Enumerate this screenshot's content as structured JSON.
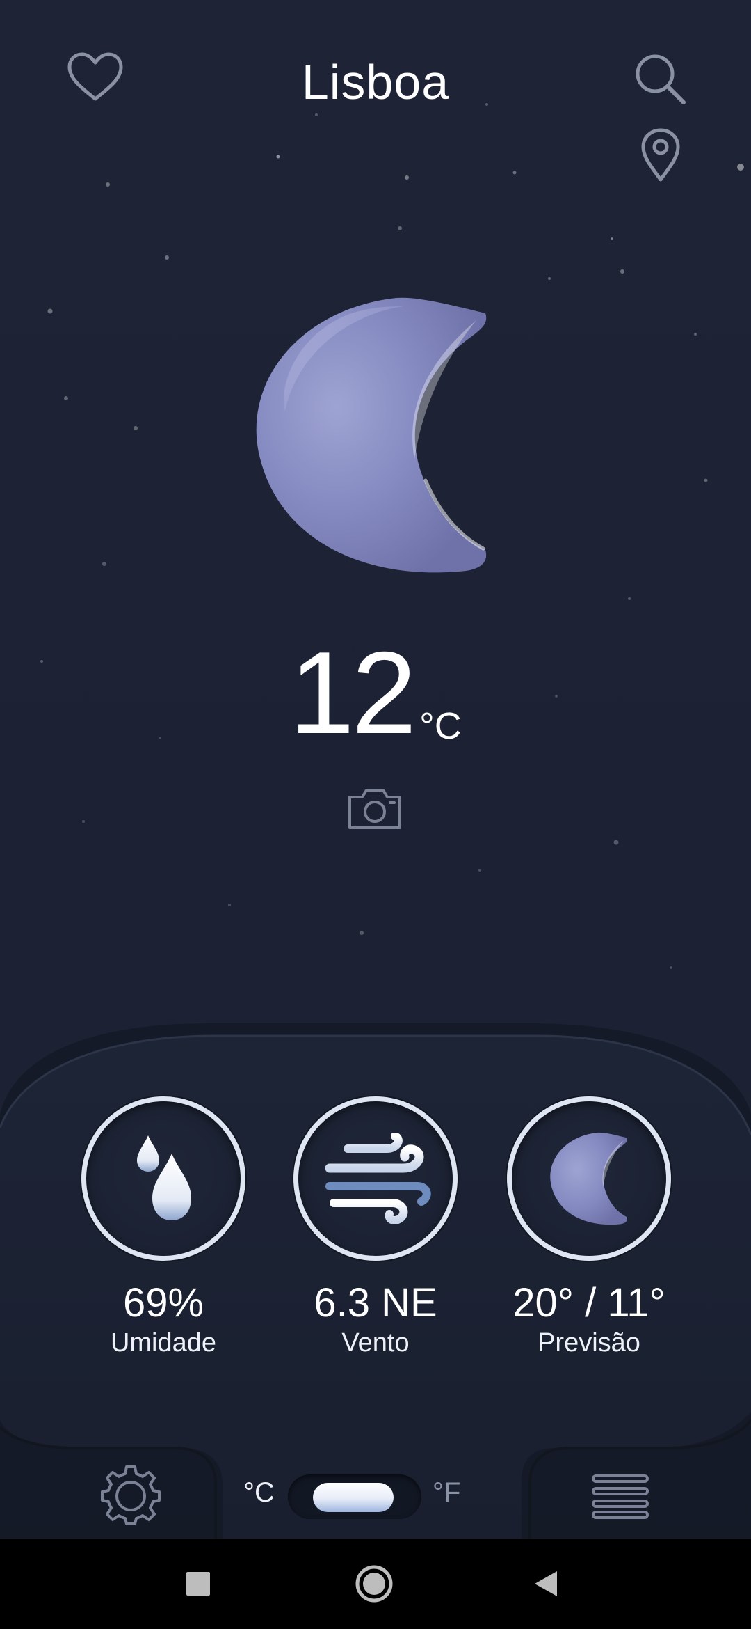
{
  "header": {
    "city": "Lisboa",
    "favorite_icon": "heart-icon",
    "search_icon": "search-icon",
    "location_icon": "location-pin-icon"
  },
  "current": {
    "condition_icon": "crescent-moon-icon",
    "temperature": "12",
    "unit": "°C",
    "camera_icon": "camera-icon"
  },
  "stats": [
    {
      "icon": "water-drops-icon",
      "value": "69%",
      "label": "Umidade"
    },
    {
      "icon": "wind-icon",
      "value": "6.3 NE",
      "label": "Vento"
    },
    {
      "icon": "crescent-moon-icon",
      "value": "20° / 11°",
      "label": "Previsão"
    }
  ],
  "bottom": {
    "settings_icon": "gear-icon",
    "unit_celsius": "°C",
    "unit_fahrenheit": "°F",
    "menu_icon": "menu-icon",
    "selected_unit": "°C"
  },
  "system_nav": {
    "recents_icon": "square-icon",
    "home_icon": "circle-icon",
    "back_icon": "back-triangle-icon"
  },
  "colors": {
    "background": "#1c2233",
    "panel": "#1a2030",
    "moon": "#8b91c4",
    "ring": "#dfe6f3"
  }
}
